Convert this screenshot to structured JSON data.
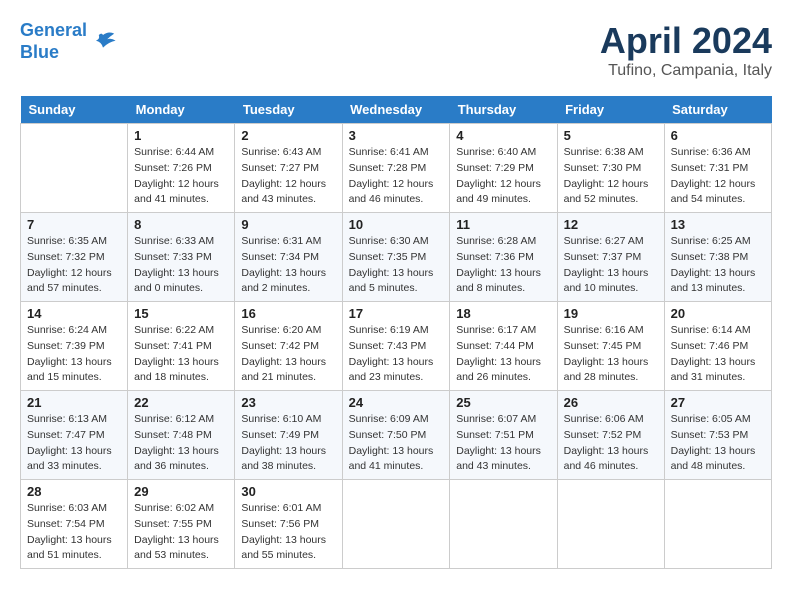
{
  "header": {
    "logo_line1": "General",
    "logo_line2": "Blue",
    "title": "April 2024",
    "subtitle": "Tufino, Campania, Italy"
  },
  "days_of_week": [
    "Sunday",
    "Monday",
    "Tuesday",
    "Wednesday",
    "Thursday",
    "Friday",
    "Saturday"
  ],
  "weeks": [
    [
      {
        "day": "",
        "sunrise": "",
        "sunset": "",
        "daylight": ""
      },
      {
        "day": "1",
        "sunrise": "Sunrise: 6:44 AM",
        "sunset": "Sunset: 7:26 PM",
        "daylight": "Daylight: 12 hours and 41 minutes."
      },
      {
        "day": "2",
        "sunrise": "Sunrise: 6:43 AM",
        "sunset": "Sunset: 7:27 PM",
        "daylight": "Daylight: 12 hours and 43 minutes."
      },
      {
        "day": "3",
        "sunrise": "Sunrise: 6:41 AM",
        "sunset": "Sunset: 7:28 PM",
        "daylight": "Daylight: 12 hours and 46 minutes."
      },
      {
        "day": "4",
        "sunrise": "Sunrise: 6:40 AM",
        "sunset": "Sunset: 7:29 PM",
        "daylight": "Daylight: 12 hours and 49 minutes."
      },
      {
        "day": "5",
        "sunrise": "Sunrise: 6:38 AM",
        "sunset": "Sunset: 7:30 PM",
        "daylight": "Daylight: 12 hours and 52 minutes."
      },
      {
        "day": "6",
        "sunrise": "Sunrise: 6:36 AM",
        "sunset": "Sunset: 7:31 PM",
        "daylight": "Daylight: 12 hours and 54 minutes."
      }
    ],
    [
      {
        "day": "7",
        "sunrise": "Sunrise: 6:35 AM",
        "sunset": "Sunset: 7:32 PM",
        "daylight": "Daylight: 12 hours and 57 minutes."
      },
      {
        "day": "8",
        "sunrise": "Sunrise: 6:33 AM",
        "sunset": "Sunset: 7:33 PM",
        "daylight": "Daylight: 13 hours and 0 minutes."
      },
      {
        "day": "9",
        "sunrise": "Sunrise: 6:31 AM",
        "sunset": "Sunset: 7:34 PM",
        "daylight": "Daylight: 13 hours and 2 minutes."
      },
      {
        "day": "10",
        "sunrise": "Sunrise: 6:30 AM",
        "sunset": "Sunset: 7:35 PM",
        "daylight": "Daylight: 13 hours and 5 minutes."
      },
      {
        "day": "11",
        "sunrise": "Sunrise: 6:28 AM",
        "sunset": "Sunset: 7:36 PM",
        "daylight": "Daylight: 13 hours and 8 minutes."
      },
      {
        "day": "12",
        "sunrise": "Sunrise: 6:27 AM",
        "sunset": "Sunset: 7:37 PM",
        "daylight": "Daylight: 13 hours and 10 minutes."
      },
      {
        "day": "13",
        "sunrise": "Sunrise: 6:25 AM",
        "sunset": "Sunset: 7:38 PM",
        "daylight": "Daylight: 13 hours and 13 minutes."
      }
    ],
    [
      {
        "day": "14",
        "sunrise": "Sunrise: 6:24 AM",
        "sunset": "Sunset: 7:39 PM",
        "daylight": "Daylight: 13 hours and 15 minutes."
      },
      {
        "day": "15",
        "sunrise": "Sunrise: 6:22 AM",
        "sunset": "Sunset: 7:41 PM",
        "daylight": "Daylight: 13 hours and 18 minutes."
      },
      {
        "day": "16",
        "sunrise": "Sunrise: 6:20 AM",
        "sunset": "Sunset: 7:42 PM",
        "daylight": "Daylight: 13 hours and 21 minutes."
      },
      {
        "day": "17",
        "sunrise": "Sunrise: 6:19 AM",
        "sunset": "Sunset: 7:43 PM",
        "daylight": "Daylight: 13 hours and 23 minutes."
      },
      {
        "day": "18",
        "sunrise": "Sunrise: 6:17 AM",
        "sunset": "Sunset: 7:44 PM",
        "daylight": "Daylight: 13 hours and 26 minutes."
      },
      {
        "day": "19",
        "sunrise": "Sunrise: 6:16 AM",
        "sunset": "Sunset: 7:45 PM",
        "daylight": "Daylight: 13 hours and 28 minutes."
      },
      {
        "day": "20",
        "sunrise": "Sunrise: 6:14 AM",
        "sunset": "Sunset: 7:46 PM",
        "daylight": "Daylight: 13 hours and 31 minutes."
      }
    ],
    [
      {
        "day": "21",
        "sunrise": "Sunrise: 6:13 AM",
        "sunset": "Sunset: 7:47 PM",
        "daylight": "Daylight: 13 hours and 33 minutes."
      },
      {
        "day": "22",
        "sunrise": "Sunrise: 6:12 AM",
        "sunset": "Sunset: 7:48 PM",
        "daylight": "Daylight: 13 hours and 36 minutes."
      },
      {
        "day": "23",
        "sunrise": "Sunrise: 6:10 AM",
        "sunset": "Sunset: 7:49 PM",
        "daylight": "Daylight: 13 hours and 38 minutes."
      },
      {
        "day": "24",
        "sunrise": "Sunrise: 6:09 AM",
        "sunset": "Sunset: 7:50 PM",
        "daylight": "Daylight: 13 hours and 41 minutes."
      },
      {
        "day": "25",
        "sunrise": "Sunrise: 6:07 AM",
        "sunset": "Sunset: 7:51 PM",
        "daylight": "Daylight: 13 hours and 43 minutes."
      },
      {
        "day": "26",
        "sunrise": "Sunrise: 6:06 AM",
        "sunset": "Sunset: 7:52 PM",
        "daylight": "Daylight: 13 hours and 46 minutes."
      },
      {
        "day": "27",
        "sunrise": "Sunrise: 6:05 AM",
        "sunset": "Sunset: 7:53 PM",
        "daylight": "Daylight: 13 hours and 48 minutes."
      }
    ],
    [
      {
        "day": "28",
        "sunrise": "Sunrise: 6:03 AM",
        "sunset": "Sunset: 7:54 PM",
        "daylight": "Daylight: 13 hours and 51 minutes."
      },
      {
        "day": "29",
        "sunrise": "Sunrise: 6:02 AM",
        "sunset": "Sunset: 7:55 PM",
        "daylight": "Daylight: 13 hours and 53 minutes."
      },
      {
        "day": "30",
        "sunrise": "Sunrise: 6:01 AM",
        "sunset": "Sunset: 7:56 PM",
        "daylight": "Daylight: 13 hours and 55 minutes."
      },
      {
        "day": "",
        "sunrise": "",
        "sunset": "",
        "daylight": ""
      },
      {
        "day": "",
        "sunrise": "",
        "sunset": "",
        "daylight": ""
      },
      {
        "day": "",
        "sunrise": "",
        "sunset": "",
        "daylight": ""
      },
      {
        "day": "",
        "sunrise": "",
        "sunset": "",
        "daylight": ""
      }
    ]
  ]
}
